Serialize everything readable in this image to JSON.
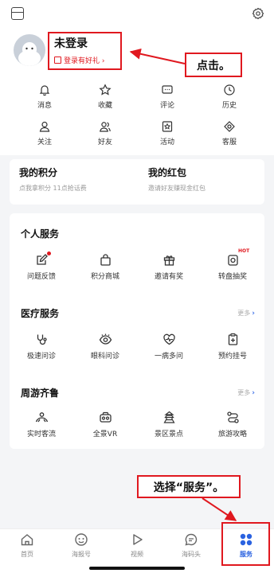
{
  "header": {
    "menu_icon": "menu-icon",
    "settings_icon": "gear-icon"
  },
  "profile": {
    "title": "未登录",
    "subtitle": "登录有好礼 ›"
  },
  "annotations": {
    "click_hint": "点击。",
    "service_hint": "选择“服务”。",
    "color": "#e0181f"
  },
  "quick_links": [
    {
      "label": "消息",
      "icon": "bell-icon"
    },
    {
      "label": "收藏",
      "icon": "star-icon"
    },
    {
      "label": "评论",
      "icon": "comment-icon"
    },
    {
      "label": "历史",
      "icon": "clock-icon"
    },
    {
      "label": "关注",
      "icon": "person-icon"
    },
    {
      "label": "好友",
      "icon": "friends-icon"
    },
    {
      "label": "活动",
      "icon": "activity-icon"
    },
    {
      "label": "客服",
      "icon": "support-icon"
    }
  ],
  "cards": {
    "points": {
      "title": "我的积分",
      "subtitle": "点我拿积分 11点抢话费"
    },
    "redpacket": {
      "title": "我的红包",
      "subtitle": "邀请好友赚现金红包"
    }
  },
  "sections": {
    "personal": {
      "title": "个人服务",
      "items": [
        {
          "label": "问题反馈",
          "icon": "edit-icon",
          "badge": "dot"
        },
        {
          "label": "积分商城",
          "icon": "bag-icon"
        },
        {
          "label": "邀请有奖",
          "icon": "gift-icon"
        },
        {
          "label": "转盘抽奖",
          "icon": "wheel-icon",
          "badge": "HOT"
        }
      ]
    },
    "medical": {
      "title": "医疗服务",
      "more": "更多",
      "items": [
        {
          "label": "极速问诊",
          "icon": "stethoscope-icon"
        },
        {
          "label": "眼科问诊",
          "icon": "eye-icon"
        },
        {
          "label": "一病多问",
          "icon": "heart-icon"
        },
        {
          "label": "预约挂号",
          "icon": "clipboard-icon"
        }
      ]
    },
    "travel": {
      "title": "周游齐鲁",
      "more": "更多",
      "items": [
        {
          "label": "实时客流",
          "icon": "crowd-icon"
        },
        {
          "label": "全景VR",
          "icon": "vr-icon"
        },
        {
          "label": "景区景点",
          "icon": "pagoda-icon"
        },
        {
          "label": "旅游攻略",
          "icon": "route-icon"
        }
      ]
    }
  },
  "bottom_nav": [
    {
      "label": "首页",
      "icon": "home-icon"
    },
    {
      "label": "海报号",
      "icon": "poster-icon"
    },
    {
      "label": "视频",
      "icon": "play-icon"
    },
    {
      "label": "海码头",
      "icon": "chat-icon"
    },
    {
      "label": "服务",
      "icon": "services-icon",
      "active": true
    }
  ]
}
